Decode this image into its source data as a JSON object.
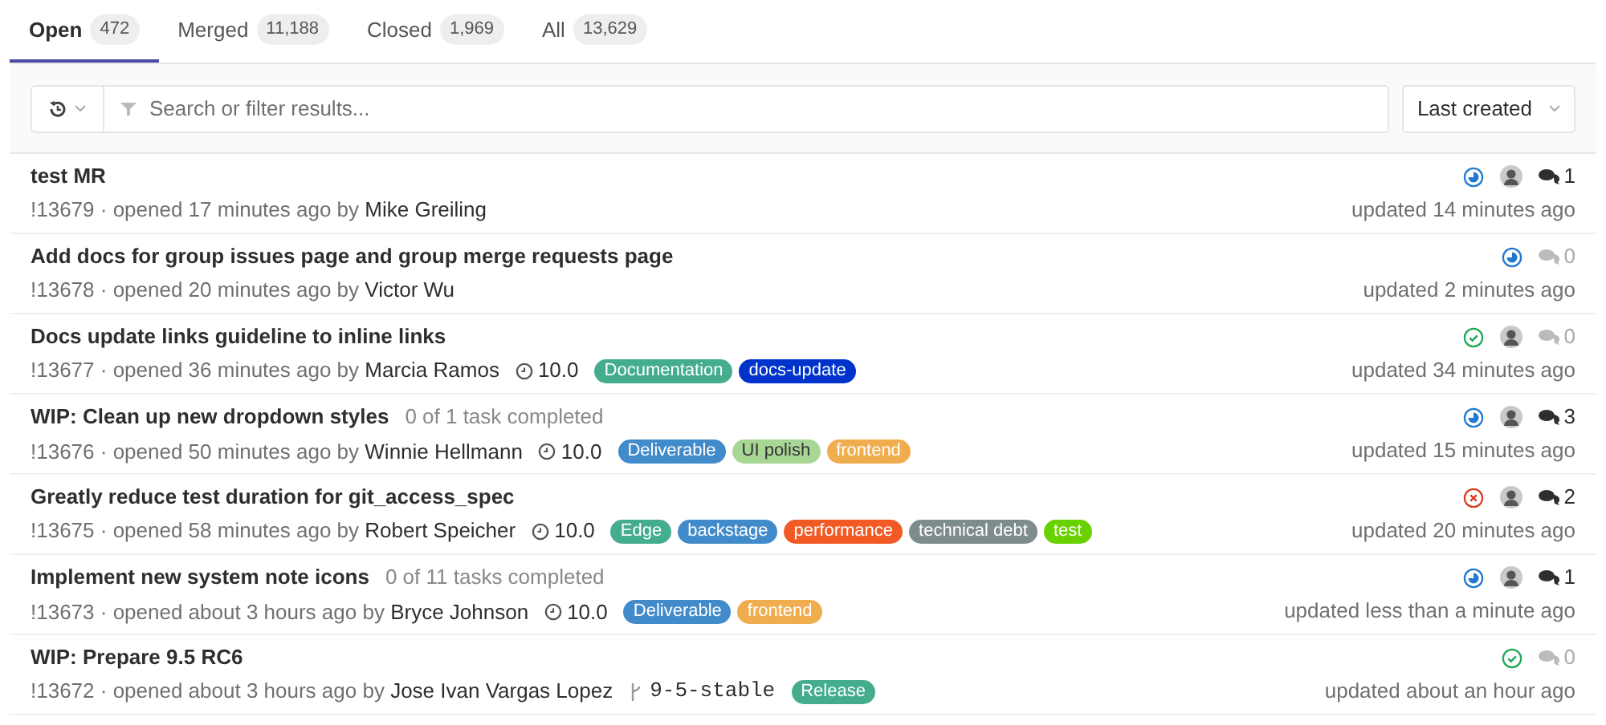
{
  "tabs": [
    {
      "label": "Open",
      "count": "472",
      "selected": true
    },
    {
      "label": "Merged",
      "count": "11,188",
      "selected": false
    },
    {
      "label": "Closed",
      "count": "1,969",
      "selected": false
    },
    {
      "label": "All",
      "count": "13,629",
      "selected": false
    }
  ],
  "search": {
    "placeholder": "Search or filter results..."
  },
  "sort": {
    "label": "Last created"
  },
  "merge_requests": [
    {
      "title": "test MR",
      "ref": "!13679",
      "opened": "· opened 17 minutes ago by",
      "author": "Mike Greiling",
      "pipeline": {
        "kind": "running"
      },
      "avatar": true,
      "comments": "1",
      "comments_muted": false,
      "updated": "updated 14 minutes ago"
    },
    {
      "title": "Add docs for group issues page and group merge requests page",
      "ref": "!13678",
      "opened": "· opened 20 minutes ago by",
      "author": "Victor Wu",
      "pipeline": {
        "kind": "running"
      },
      "avatar": false,
      "comments": "0",
      "comments_muted": true,
      "updated": "updated 2 minutes ago"
    },
    {
      "title": "Docs update links guideline to inline links",
      "ref": "!13677",
      "opened": "· opened 36 minutes ago by",
      "author": "Marcia Ramos",
      "milestone": "10.0",
      "labels": [
        {
          "text": "Documentation",
          "color": "#44ad8e"
        },
        {
          "text": "docs-update",
          "color": "#0033cc"
        }
      ],
      "pipeline": {
        "kind": "success"
      },
      "avatar": true,
      "comments": "0",
      "comments_muted": true,
      "updated": "updated 34 minutes ago"
    },
    {
      "title": "WIP: Clean up new dropdown styles",
      "tasks": "0 of 1 task completed",
      "ref": "!13676",
      "opened": "· opened 50 minutes ago by",
      "author": "Winnie Hellmann",
      "milestone": "10.0",
      "labels": [
        {
          "text": "Deliverable",
          "color": "#428bca"
        },
        {
          "text": "UI polish",
          "color": "#a8d695"
        },
        {
          "text": "frontend",
          "color": "#f0ad4e"
        }
      ],
      "pipeline": {
        "kind": "running"
      },
      "avatar": true,
      "comments": "3",
      "comments_muted": false,
      "updated": "updated 15 minutes ago"
    },
    {
      "title": "Greatly reduce test duration for git_access_spec",
      "ref": "!13675",
      "opened": "· opened 58 minutes ago by",
      "author": "Robert Speicher",
      "milestone": "10.0",
      "labels": [
        {
          "text": "Edge",
          "color": "#44ad8e"
        },
        {
          "text": "backstage",
          "color": "#428bca"
        },
        {
          "text": "performance",
          "color": "#f15a24"
        },
        {
          "text": "technical debt",
          "color": "#7f8c8d"
        },
        {
          "text": "test",
          "color": "#69d100"
        }
      ],
      "pipeline": {
        "kind": "failed"
      },
      "avatar": true,
      "comments": "2",
      "comments_muted": false,
      "updated": "updated 20 minutes ago"
    },
    {
      "title": "Implement new system note icons",
      "tasks": "0 of 11 tasks completed",
      "ref": "!13673",
      "opened": "· opened about 3 hours ago by",
      "author": "Bryce Johnson",
      "milestone": "10.0",
      "labels": [
        {
          "text": "Deliverable",
          "color": "#428bca"
        },
        {
          "text": "frontend",
          "color": "#f0ad4e"
        }
      ],
      "pipeline": {
        "kind": "running"
      },
      "avatar": true,
      "comments": "1",
      "comments_muted": false,
      "updated": "updated less than a minute ago"
    },
    {
      "title": "WIP: Prepare 9.5 RC6",
      "ref": "!13672",
      "opened": "· opened about 3 hours ago by",
      "author": "Jose Ivan Vargas Lopez",
      "branch": "9-5-stable",
      "labels": [
        {
          "text": "Release",
          "color": "#44ad8e"
        }
      ],
      "pipeline": {
        "kind": "success"
      },
      "avatar": false,
      "comments": "0",
      "comments_muted": true,
      "updated": "updated about an hour ago"
    }
  ]
}
